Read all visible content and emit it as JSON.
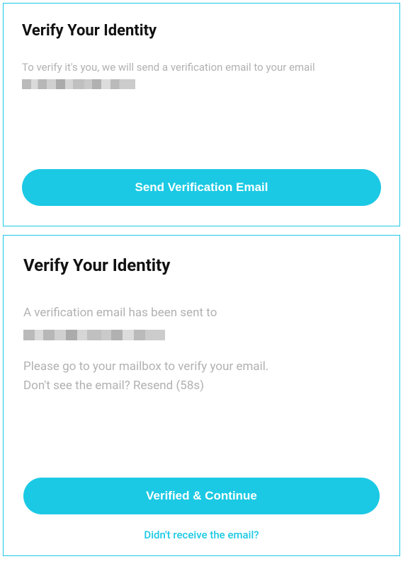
{
  "card1": {
    "title": "Verify Your Identity",
    "desc_prefix": "To verify it's you, we will send a verification email to your email ",
    "button_send": "Send Verification Email"
  },
  "card2": {
    "title": "Verify Your Identity",
    "sent_line": "A verification email has been sent to",
    "instruct_line": "Please go to your mailbox to verify your email.",
    "resend_line": "Don't see the email? Resend (58s)",
    "button_verified": "Verified & Continue",
    "link_not_received": "Didn't receive the email?"
  }
}
